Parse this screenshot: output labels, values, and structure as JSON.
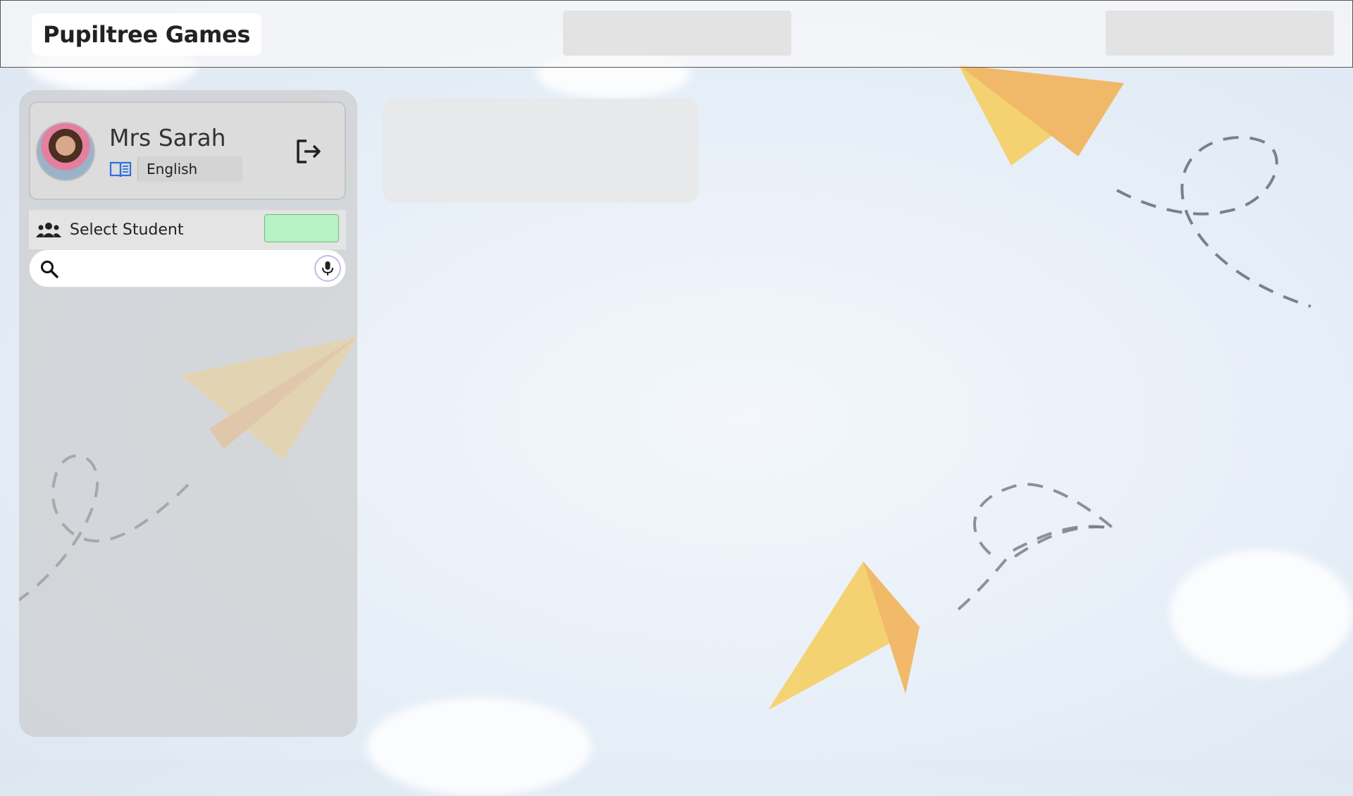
{
  "header": {
    "brand": "Pupiltree Games"
  },
  "teacher": {
    "name": "Mrs Sarah",
    "subject": "English",
    "subject_icon": "book-icon",
    "avatar": "teacher-avatar"
  },
  "students": {
    "label": "Select Student",
    "label_icon": "group-icon"
  },
  "search": {
    "placeholder": "",
    "value": "",
    "mic_icon": "microphone-icon",
    "search_icon": "search-icon"
  },
  "colors": {
    "accent_green": "#b6f2c3",
    "book_blue": "#2f6fe0",
    "paper_plane": "#f4c55a"
  }
}
